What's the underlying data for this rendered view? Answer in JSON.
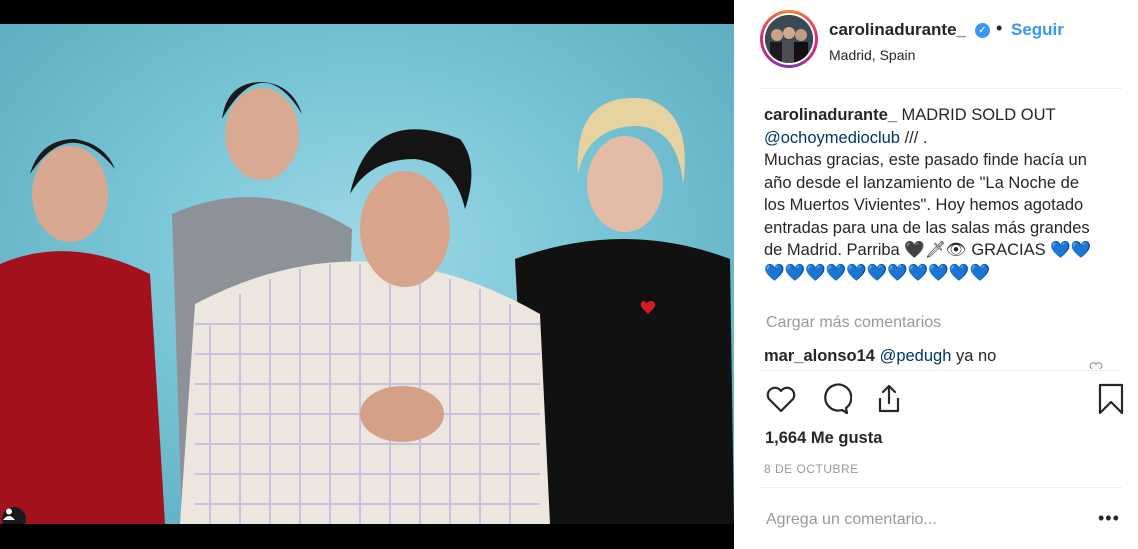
{
  "post": {
    "username": "carolinadurante_",
    "follow_label": "Seguir",
    "separator": "•",
    "location": "Madrid, Spain"
  },
  "caption": {
    "username": "carolinadurante_",
    "line1": " MADRID SOLD OUT",
    "mention": "@ochoymedioclub",
    "after_mention": " /// .",
    "body": "Muchas gracias, este pasado finde hacía un año desde el lanzamiento de \"La Noche de los Muertos Vivientes\". Hoy hemos agotado entradas para una de las salas más grandes de Madrid. Parriba 🖤🗡👁 GRACIAS 💙💙💙💙💙💙💙💙💙💙💙💙💙"
  },
  "load_more": "Cargar más comentarios",
  "reply": {
    "username": "mar_alonso14",
    "mention": "@pedugh",
    "text": " ya no"
  },
  "likes": "1,664 Me gusta",
  "date": "8 DE OCTUBRE",
  "add_comment_placeholder": "Agrega un comentario...",
  "more_label": "•••",
  "icons": {
    "like": "heart-icon",
    "comment": "comment-icon",
    "share": "share-icon",
    "save": "bookmark-icon",
    "tag": "user-tag-icon",
    "verified": "verified-badge-icon"
  },
  "colors": {
    "accent": "#3897f0",
    "mention": "#003569",
    "muted": "#999999"
  }
}
